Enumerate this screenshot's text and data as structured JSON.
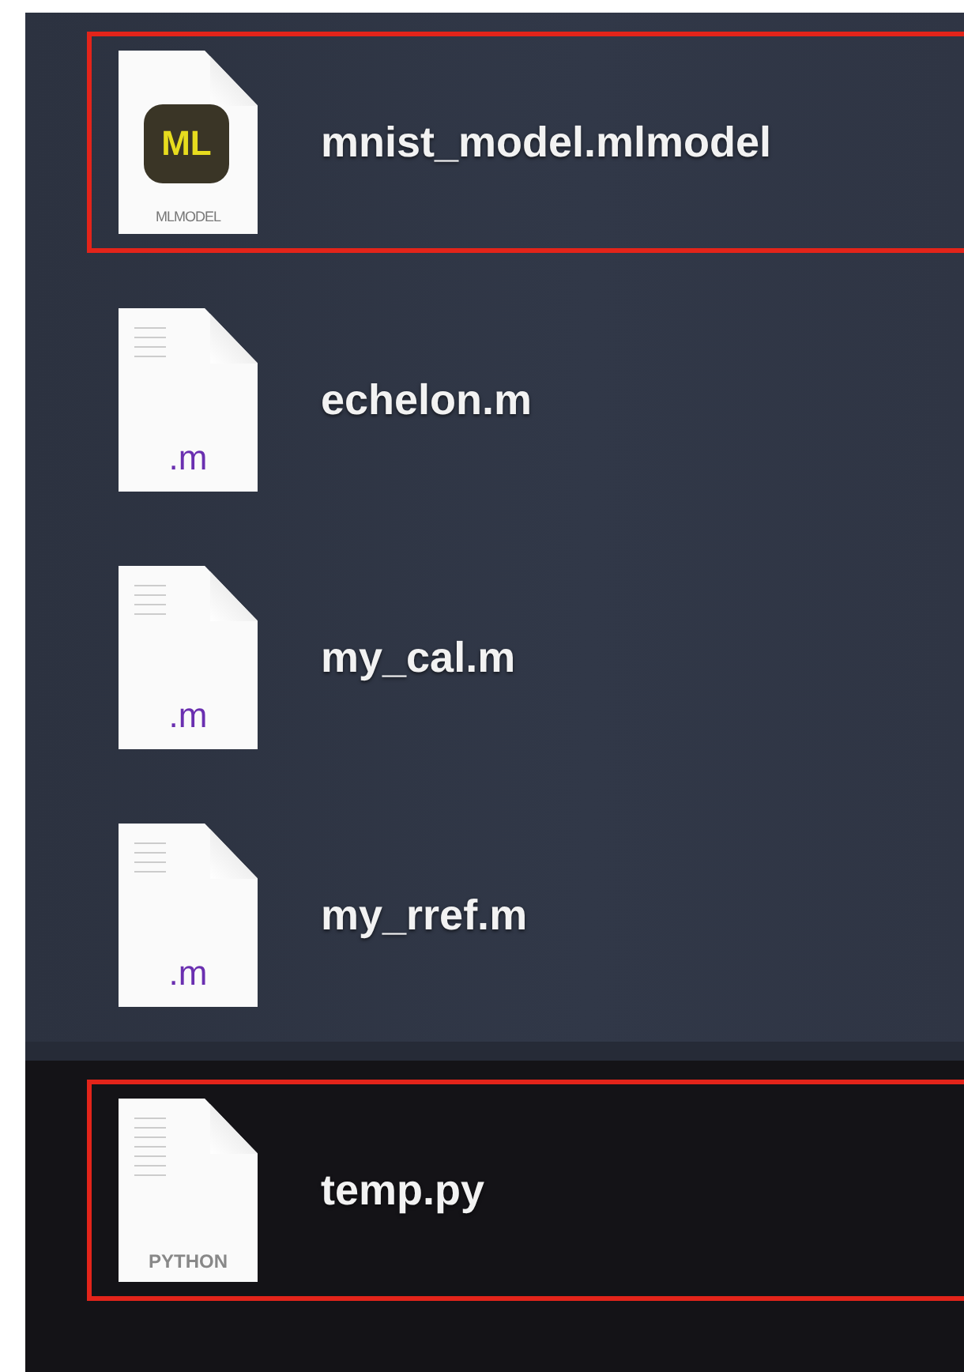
{
  "groups": [
    {
      "kind": "list",
      "items": [
        {
          "name": "mnist_model.mlmodel",
          "highlighted": true,
          "icon": {
            "kind": "mlmodel",
            "badge": "ML",
            "caption": "MLMODEL"
          }
        },
        {
          "name": "echelon.m",
          "highlighted": false,
          "icon": {
            "kind": "source",
            "caption": ".m"
          }
        },
        {
          "name": "my_cal.m",
          "highlighted": false,
          "icon": {
            "kind": "source",
            "caption": ".m"
          }
        },
        {
          "name": "my_rref.m",
          "highlighted": false,
          "icon": {
            "kind": "source",
            "caption": ".m"
          }
        }
      ]
    },
    {
      "kind": "dark",
      "items": [
        {
          "name": "temp.py",
          "highlighted": true,
          "icon": {
            "kind": "python",
            "caption": "PYTHON"
          }
        }
      ]
    }
  ]
}
